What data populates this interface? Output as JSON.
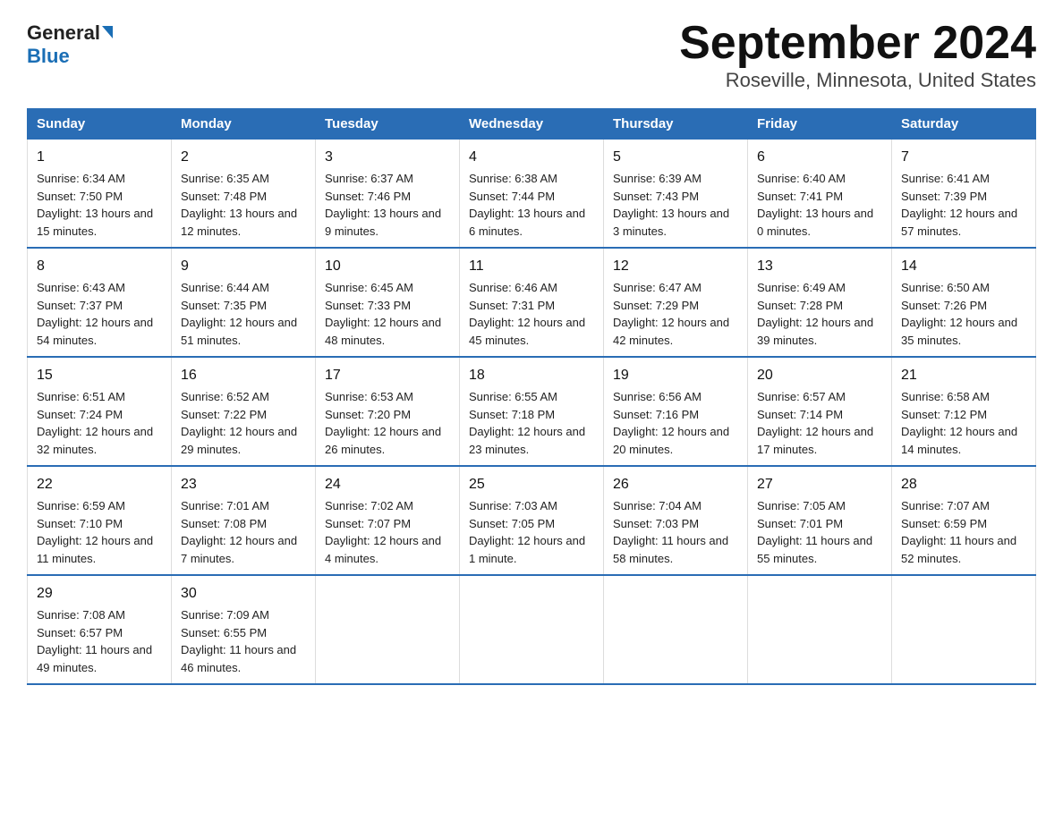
{
  "logo": {
    "general": "General",
    "blue": "Blue"
  },
  "title": "September 2024",
  "subtitle": "Roseville, Minnesota, United States",
  "headers": [
    "Sunday",
    "Monday",
    "Tuesday",
    "Wednesday",
    "Thursday",
    "Friday",
    "Saturday"
  ],
  "weeks": [
    [
      {
        "day": "1",
        "sunrise": "6:34 AM",
        "sunset": "7:50 PM",
        "daylight": "13 hours and 15 minutes."
      },
      {
        "day": "2",
        "sunrise": "6:35 AM",
        "sunset": "7:48 PM",
        "daylight": "13 hours and 12 minutes."
      },
      {
        "day": "3",
        "sunrise": "6:37 AM",
        "sunset": "7:46 PM",
        "daylight": "13 hours and 9 minutes."
      },
      {
        "day": "4",
        "sunrise": "6:38 AM",
        "sunset": "7:44 PM",
        "daylight": "13 hours and 6 minutes."
      },
      {
        "day": "5",
        "sunrise": "6:39 AM",
        "sunset": "7:43 PM",
        "daylight": "13 hours and 3 minutes."
      },
      {
        "day": "6",
        "sunrise": "6:40 AM",
        "sunset": "7:41 PM",
        "daylight": "13 hours and 0 minutes."
      },
      {
        "day": "7",
        "sunrise": "6:41 AM",
        "sunset": "7:39 PM",
        "daylight": "12 hours and 57 minutes."
      }
    ],
    [
      {
        "day": "8",
        "sunrise": "6:43 AM",
        "sunset": "7:37 PM",
        "daylight": "12 hours and 54 minutes."
      },
      {
        "day": "9",
        "sunrise": "6:44 AM",
        "sunset": "7:35 PM",
        "daylight": "12 hours and 51 minutes."
      },
      {
        "day": "10",
        "sunrise": "6:45 AM",
        "sunset": "7:33 PM",
        "daylight": "12 hours and 48 minutes."
      },
      {
        "day": "11",
        "sunrise": "6:46 AM",
        "sunset": "7:31 PM",
        "daylight": "12 hours and 45 minutes."
      },
      {
        "day": "12",
        "sunrise": "6:47 AM",
        "sunset": "7:29 PM",
        "daylight": "12 hours and 42 minutes."
      },
      {
        "day": "13",
        "sunrise": "6:49 AM",
        "sunset": "7:28 PM",
        "daylight": "12 hours and 39 minutes."
      },
      {
        "day": "14",
        "sunrise": "6:50 AM",
        "sunset": "7:26 PM",
        "daylight": "12 hours and 35 minutes."
      }
    ],
    [
      {
        "day": "15",
        "sunrise": "6:51 AM",
        "sunset": "7:24 PM",
        "daylight": "12 hours and 32 minutes."
      },
      {
        "day": "16",
        "sunrise": "6:52 AM",
        "sunset": "7:22 PM",
        "daylight": "12 hours and 29 minutes."
      },
      {
        "day": "17",
        "sunrise": "6:53 AM",
        "sunset": "7:20 PM",
        "daylight": "12 hours and 26 minutes."
      },
      {
        "day": "18",
        "sunrise": "6:55 AM",
        "sunset": "7:18 PM",
        "daylight": "12 hours and 23 minutes."
      },
      {
        "day": "19",
        "sunrise": "6:56 AM",
        "sunset": "7:16 PM",
        "daylight": "12 hours and 20 minutes."
      },
      {
        "day": "20",
        "sunrise": "6:57 AM",
        "sunset": "7:14 PM",
        "daylight": "12 hours and 17 minutes."
      },
      {
        "day": "21",
        "sunrise": "6:58 AM",
        "sunset": "7:12 PM",
        "daylight": "12 hours and 14 minutes."
      }
    ],
    [
      {
        "day": "22",
        "sunrise": "6:59 AM",
        "sunset": "7:10 PM",
        "daylight": "12 hours and 11 minutes."
      },
      {
        "day": "23",
        "sunrise": "7:01 AM",
        "sunset": "7:08 PM",
        "daylight": "12 hours and 7 minutes."
      },
      {
        "day": "24",
        "sunrise": "7:02 AM",
        "sunset": "7:07 PM",
        "daylight": "12 hours and 4 minutes."
      },
      {
        "day": "25",
        "sunrise": "7:03 AM",
        "sunset": "7:05 PM",
        "daylight": "12 hours and 1 minute."
      },
      {
        "day": "26",
        "sunrise": "7:04 AM",
        "sunset": "7:03 PM",
        "daylight": "11 hours and 58 minutes."
      },
      {
        "day": "27",
        "sunrise": "7:05 AM",
        "sunset": "7:01 PM",
        "daylight": "11 hours and 55 minutes."
      },
      {
        "day": "28",
        "sunrise": "7:07 AM",
        "sunset": "6:59 PM",
        "daylight": "11 hours and 52 minutes."
      }
    ],
    [
      {
        "day": "29",
        "sunrise": "7:08 AM",
        "sunset": "6:57 PM",
        "daylight": "11 hours and 49 minutes."
      },
      {
        "day": "30",
        "sunrise": "7:09 AM",
        "sunset": "6:55 PM",
        "daylight": "11 hours and 46 minutes."
      },
      null,
      null,
      null,
      null,
      null
    ]
  ],
  "labels": {
    "sunrise": "Sunrise:",
    "sunset": "Sunset:",
    "daylight": "Daylight:"
  }
}
